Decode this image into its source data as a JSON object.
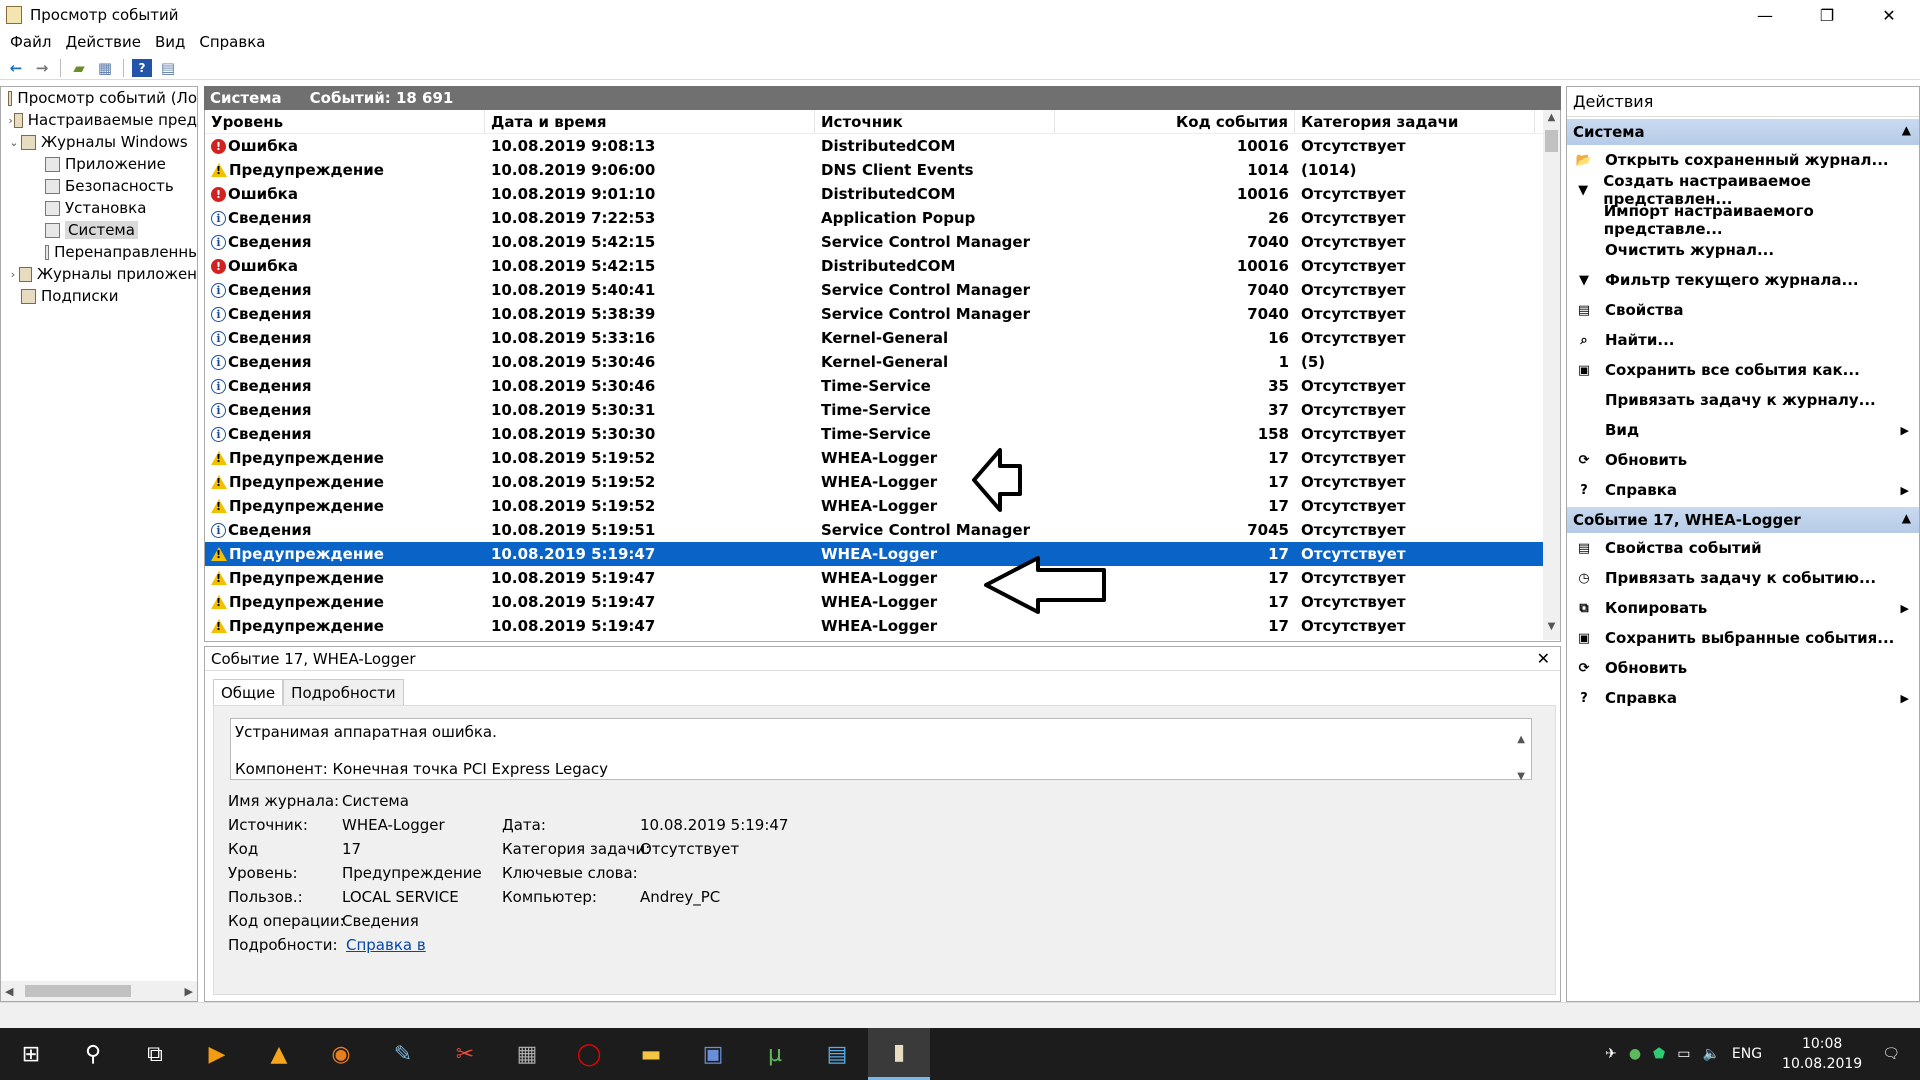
{
  "window": {
    "title": "Просмотр событий",
    "minimize": "—",
    "restore": "❐",
    "close": "✕"
  },
  "menu": [
    "Файл",
    "Действие",
    "Вид",
    "Справка"
  ],
  "tree": [
    {
      "label": "Просмотр событий (Ло",
      "level": 0,
      "expander": ""
    },
    {
      "label": "Настраиваемые пред",
      "level": 1,
      "expander": "›"
    },
    {
      "label": "Журналы Windows",
      "level": 1,
      "expander": "⌄"
    },
    {
      "label": "Приложение",
      "level": 2,
      "expander": ""
    },
    {
      "label": "Безопасность",
      "level": 2,
      "expander": ""
    },
    {
      "label": "Установка",
      "level": 2,
      "expander": ""
    },
    {
      "label": "Система",
      "level": 2,
      "expander": "",
      "selected": true
    },
    {
      "label": "Перенаправленнь",
      "level": 2,
      "expander": ""
    },
    {
      "label": "Журналы приложен",
      "level": 1,
      "expander": "›"
    },
    {
      "label": "Подписки",
      "level": 1,
      "expander": ""
    }
  ],
  "list": {
    "log_name": "Система",
    "count_text": "Событий: 18 691",
    "columns": {
      "level": "Уровень",
      "date": "Дата и время",
      "source": "Источник",
      "code": "Код события",
      "category": "Категория задачи"
    },
    "rows": [
      {
        "type": "err",
        "level": "Ошибка",
        "date": "10.08.2019 9:08:13",
        "source": "DistributedCOM",
        "code": "10016",
        "category": "Отсутствует"
      },
      {
        "type": "warn",
        "level": "Предупреждение",
        "date": "10.08.2019 9:06:00",
        "source": "DNS Client Events",
        "code": "1014",
        "category": "(1014)"
      },
      {
        "type": "err",
        "level": "Ошибка",
        "date": "10.08.2019 9:01:10",
        "source": "DistributedCOM",
        "code": "10016",
        "category": "Отсутствует"
      },
      {
        "type": "info",
        "level": "Сведения",
        "date": "10.08.2019 7:22:53",
        "source": "Application Popup",
        "code": "26",
        "category": "Отсутствует"
      },
      {
        "type": "info",
        "level": "Сведения",
        "date": "10.08.2019 5:42:15",
        "source": "Service Control Manager",
        "code": "7040",
        "category": "Отсутствует"
      },
      {
        "type": "err",
        "level": "Ошибка",
        "date": "10.08.2019 5:42:15",
        "source": "DistributedCOM",
        "code": "10016",
        "category": "Отсутствует"
      },
      {
        "type": "info",
        "level": "Сведения",
        "date": "10.08.2019 5:40:41",
        "source": "Service Control Manager",
        "code": "7040",
        "category": "Отсутствует"
      },
      {
        "type": "info",
        "level": "Сведения",
        "date": "10.08.2019 5:38:39",
        "source": "Service Control Manager",
        "code": "7040",
        "category": "Отсутствует"
      },
      {
        "type": "info",
        "level": "Сведения",
        "date": "10.08.2019 5:33:16",
        "source": "Kernel-General",
        "code": "16",
        "category": "Отсутствует"
      },
      {
        "type": "info",
        "level": "Сведения",
        "date": "10.08.2019 5:30:46",
        "source": "Kernel-General",
        "code": "1",
        "category": "(5)"
      },
      {
        "type": "info",
        "level": "Сведения",
        "date": "10.08.2019 5:30:46",
        "source": "Time-Service",
        "code": "35",
        "category": "Отсутствует"
      },
      {
        "type": "info",
        "level": "Сведения",
        "date": "10.08.2019 5:30:31",
        "source": "Time-Service",
        "code": "37",
        "category": "Отсутствует"
      },
      {
        "type": "info",
        "level": "Сведения",
        "date": "10.08.2019 5:30:30",
        "source": "Time-Service",
        "code": "158",
        "category": "Отсутствует"
      },
      {
        "type": "warn",
        "level": "Предупреждение",
        "date": "10.08.2019 5:19:52",
        "source": "WHEA-Logger",
        "code": "17",
        "category": "Отсутствует"
      },
      {
        "type": "warn",
        "level": "Предупреждение",
        "date": "10.08.2019 5:19:52",
        "source": "WHEA-Logger",
        "code": "17",
        "category": "Отсутствует"
      },
      {
        "type": "warn",
        "level": "Предупреждение",
        "date": "10.08.2019 5:19:52",
        "source": "WHEA-Logger",
        "code": "17",
        "category": "Отсутствует"
      },
      {
        "type": "info",
        "level": "Сведения",
        "date": "10.08.2019 5:19:51",
        "source": "Service Control Manager",
        "code": "7045",
        "category": "Отсутствует"
      },
      {
        "type": "warn",
        "level": "Предупреждение",
        "date": "10.08.2019 5:19:47",
        "source": "WHEA-Logger",
        "code": "17",
        "category": "Отсутствует",
        "selected": true
      },
      {
        "type": "warn",
        "level": "Предупреждение",
        "date": "10.08.2019 5:19:47",
        "source": "WHEA-Logger",
        "code": "17",
        "category": "Отсутствует"
      },
      {
        "type": "warn",
        "level": "Предупреждение",
        "date": "10.08.2019 5:19:47",
        "source": "WHEA-Logger",
        "code": "17",
        "category": "Отсутствует"
      },
      {
        "type": "warn",
        "level": "Предупреждение",
        "date": "10.08.2019 5:19:47",
        "source": "WHEA-Logger",
        "code": "17",
        "category": "Отсутствует"
      }
    ]
  },
  "detail": {
    "title": "Событие 17, WHEA-Logger",
    "tabs": [
      "Общие",
      "Подробности"
    ],
    "description_line1": "Устранимая аппаратная ошибка.",
    "description_line2": "Компонент: Конечная точка PCI Express Legacy",
    "props": {
      "log_label": "Имя журнала:",
      "log_value": "Система",
      "source_label": "Источник:",
      "source_value": "WHEA-Logger",
      "date_label": "Дата:",
      "date_value": "10.08.2019 5:19:47",
      "code_label": "Код",
      "code_value": "17",
      "cat_label": "Категория задачи:",
      "cat_value": "Отсутствует",
      "level_label": "Уровень:",
      "level_value": "Предупреждение",
      "keywords_label": "Ключевые слова:",
      "keywords_value": "",
      "user_label": "Пользов.:",
      "user_value": "LOCAL SERVICE",
      "computer_label": "Компьютер:",
      "computer_value": "Andrey_PC",
      "opcode_label": "Код операции:",
      "opcode_value": "Сведения",
      "more_label": "Подробности:",
      "more_link": "Справка в "
    }
  },
  "actions": {
    "title": "Действия",
    "group1": {
      "title": "Система",
      "items": [
        {
          "icon": "open-folder-icon",
          "glyph": "📂",
          "label": "Открыть сохраненный журнал..."
        },
        {
          "icon": "filter-icon",
          "glyph": "▼",
          "label": "Создать настраиваемое представлен..."
        },
        {
          "icon": "",
          "glyph": "",
          "label": "Импорт настраиваемого представле..."
        },
        {
          "icon": "",
          "glyph": "",
          "label": "Очистить журнал..."
        },
        {
          "icon": "filter-icon",
          "glyph": "▼",
          "label": "Фильтр текущего журнала..."
        },
        {
          "icon": "properties-icon",
          "glyph": "▤",
          "label": "Свойства"
        },
        {
          "icon": "find-icon",
          "glyph": "⌕",
          "label": "Найти..."
        },
        {
          "icon": "save-icon",
          "glyph": "▣",
          "label": "Сохранить все события как..."
        },
        {
          "icon": "",
          "glyph": "",
          "label": "Привязать задачу к журналу..."
        },
        {
          "icon": "",
          "glyph": "",
          "label": "Вид",
          "submenu": true
        },
        {
          "icon": "refresh-icon",
          "glyph": "⟳",
          "label": "Обновить"
        },
        {
          "icon": "help-icon",
          "glyph": "?",
          "label": "Справка",
          "submenu": true
        }
      ]
    },
    "group2": {
      "title": "Событие 17, WHEA-Logger",
      "items": [
        {
          "icon": "event-properties-icon",
          "glyph": "▤",
          "label": "Свойства событий"
        },
        {
          "icon": "attach-task-icon",
          "glyph": "◷",
          "label": "Привязать задачу к событию..."
        },
        {
          "icon": "copy-icon",
          "glyph": "⧉",
          "label": "Копировать",
          "submenu": true
        },
        {
          "icon": "save-icon",
          "glyph": "▣",
          "label": "Сохранить выбранные события..."
        },
        {
          "icon": "refresh-icon",
          "glyph": "⟳",
          "label": "Обновить"
        },
        {
          "icon": "help-icon",
          "glyph": "?",
          "label": "Справка",
          "submenu": true
        }
      ]
    }
  },
  "taskbar": {
    "lang": "ENG",
    "time": "10:08",
    "date": "10.08.2019"
  }
}
